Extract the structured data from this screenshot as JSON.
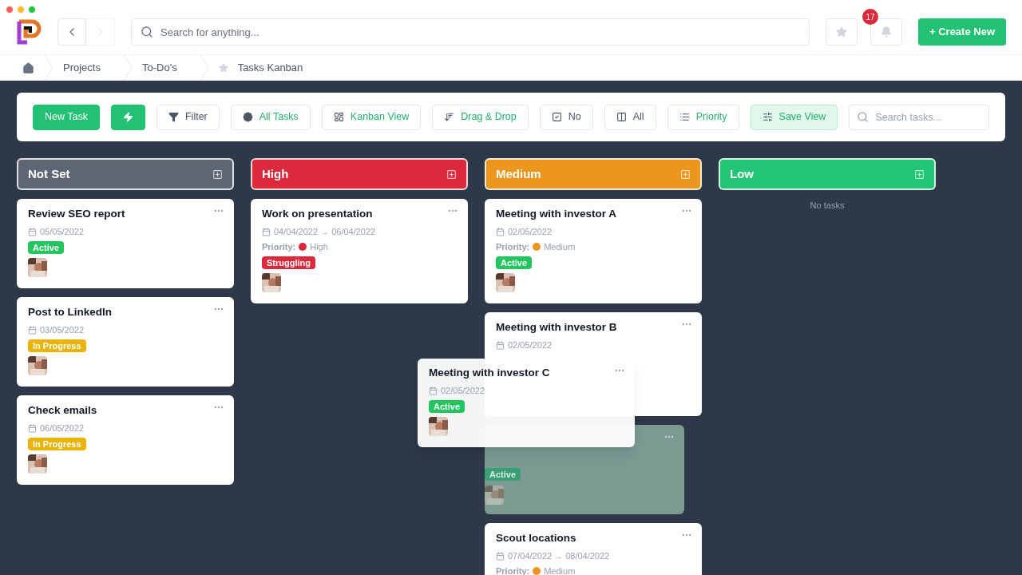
{
  "topbar": {
    "search_placeholder": "Search for anything...",
    "notification_count": "17",
    "create_button": "+ Create New"
  },
  "breadcrumbs": [
    {
      "label": "Projects",
      "starred": false
    },
    {
      "label": "To-Do's",
      "starred": false
    },
    {
      "label": "Tasks Kanban",
      "starred": true
    }
  ],
  "toolbar": {
    "buttons": [
      {
        "label": "New Task",
        "kind": "primary"
      },
      {
        "kind": "primary"
      },
      {
        "label": "Filter",
        "kind": "plain"
      },
      {
        "label": "All Tasks",
        "kind": "accent"
      },
      {
        "label": "Kanban View",
        "kind": "accent"
      },
      {
        "label": "Drag & Drop",
        "kind": "accent"
      },
      {
        "label": "No",
        "kind": "plain"
      },
      {
        "label": "All",
        "kind": "plain"
      },
      {
        "label": "Priority",
        "kind": "accent"
      },
      {
        "label": "Save View",
        "kind": "active"
      }
    ],
    "search_placeholder": "Search tasks..."
  },
  "columns": [
    {
      "title": "Not Set",
      "color": "#5f6673",
      "cards": [
        {
          "kind": "card",
          "title": "Review SEO report",
          "date": "05/05/2022",
          "tag": {
            "label": "Active",
            "color": "#22c55e"
          }
        },
        {
          "kind": "card",
          "title": "Post to LinkedIn",
          "date": "03/05/2022",
          "tag": {
            "label": "In Progress",
            "color": "#eab308"
          }
        },
        {
          "kind": "card",
          "title": "Check emails",
          "date": "06/05/2022",
          "tag": {
            "label": "In Progress",
            "color": "#eab308"
          }
        }
      ]
    },
    {
      "title": "High",
      "color": "#dc2a3c",
      "cards": [
        {
          "kind": "card",
          "title": "Work on presentation",
          "date": "04/04/2022 → 06/04/2022",
          "priority": {
            "label": "Priority:",
            "value": "High",
            "color": "#dc2a3c"
          },
          "tag": {
            "label": "Struggling",
            "color": "#dc2a3c"
          }
        }
      ]
    },
    {
      "title": "Medium",
      "color": "#eb961e",
      "cards": [
        {
          "kind": "card",
          "title": "Meeting with investor A",
          "date": "02/05/2022",
          "priority": {
            "label": "Priority:",
            "value": "Medium",
            "color": "#eb961e"
          },
          "tag": {
            "label": "Active",
            "color": "#22c55e"
          }
        },
        {
          "kind": "covered",
          "title": "Meeting with investor B",
          "date": "02/05/2022"
        },
        {
          "kind": "placeholder",
          "tag": {
            "label": "Active",
            "color": "#3a9f74"
          }
        },
        {
          "kind": "card",
          "title": "Scout locations",
          "date": "07/04/2022 → 08/04/2022",
          "priority": {
            "label": "Priority:",
            "value": "Medium",
            "color": "#eb961e"
          }
        }
      ]
    },
    {
      "title": "Low",
      "color": "#22c573",
      "empty_text": "No tasks"
    }
  ],
  "dragged_card": {
    "title": "Meeting with investor C",
    "date": "02/05/2022",
    "tag": {
      "label": "Active",
      "color": "#22c55e"
    }
  }
}
